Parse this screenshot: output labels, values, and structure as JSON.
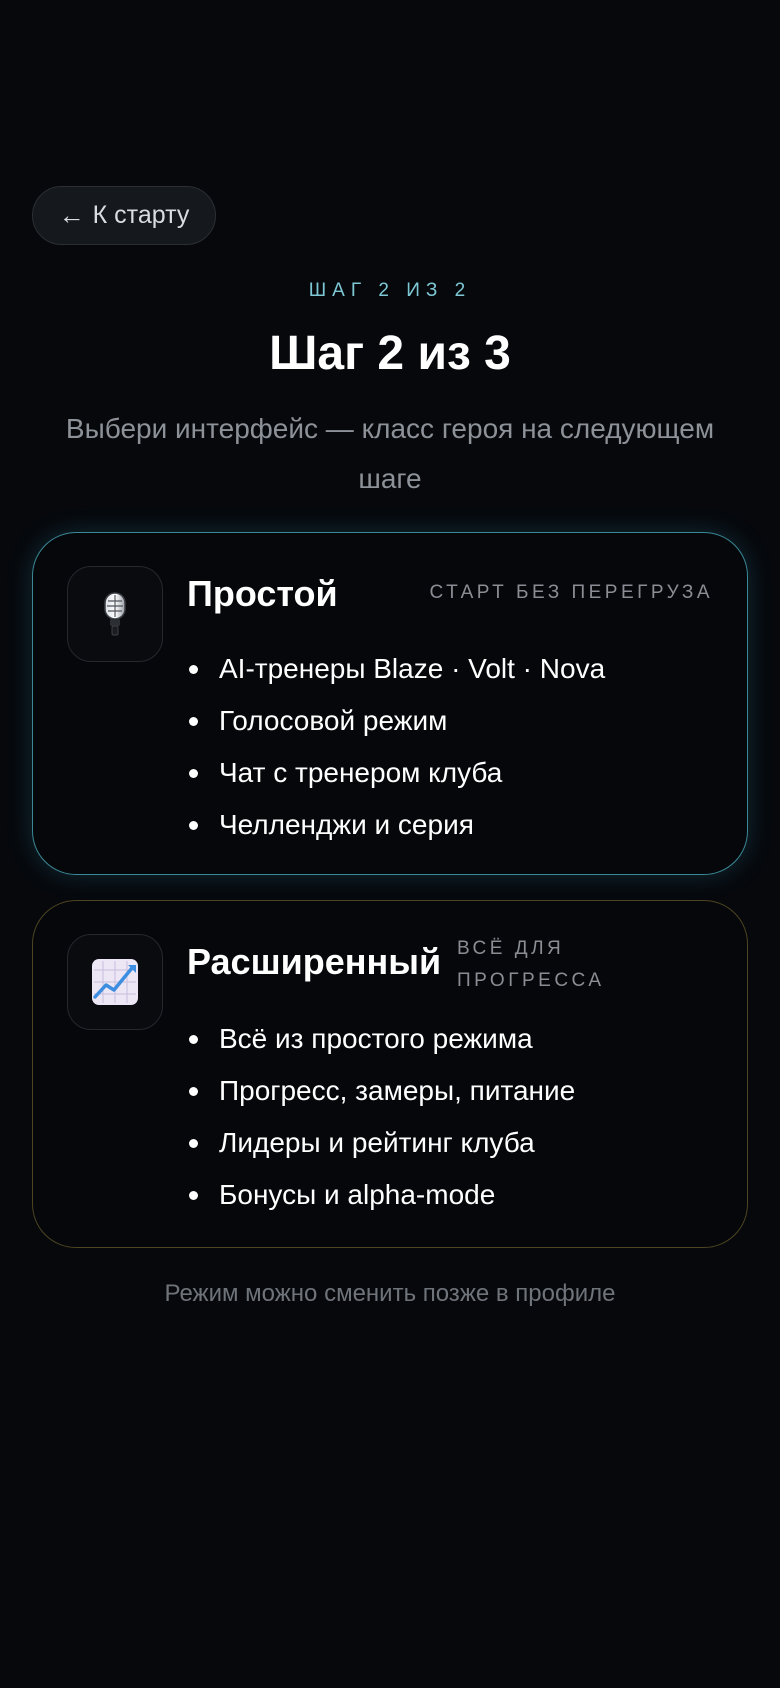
{
  "nav": {
    "back_label": "К старту",
    "back_icon": "arrow-left-icon"
  },
  "header": {
    "kicker": "ШАГ 2 ИЗ 2",
    "title": "Шаг 2 из 3",
    "subtitle": "Выбери интерфейс — класс героя на следующем шаге"
  },
  "cards": [
    {
      "id": "simple",
      "icon": "microphone-icon",
      "title": "Простой",
      "tag": "СТАРТ БЕЗ ПЕРЕГРУЗА",
      "accent": "#3a8796",
      "features": [
        "AI-тренеры Blaze · Volt · Nova",
        "Голосовой режим",
        "Чат с тренером клуба",
        "Челленджи и серия"
      ]
    },
    {
      "id": "advanced",
      "icon": "chart-increasing-icon",
      "title": "Расширенный",
      "tag": "ВСЁ ДЛЯ ПРОГРЕССА",
      "accent": "#4d4420",
      "features": [
        "Всё из простого режима",
        "Прогресс, замеры, питание",
        "Лидеры и рейтинг клуба",
        "Бонусы и alpha-mode"
      ]
    }
  ],
  "footnote": "Режим можно сменить позже в профиле"
}
